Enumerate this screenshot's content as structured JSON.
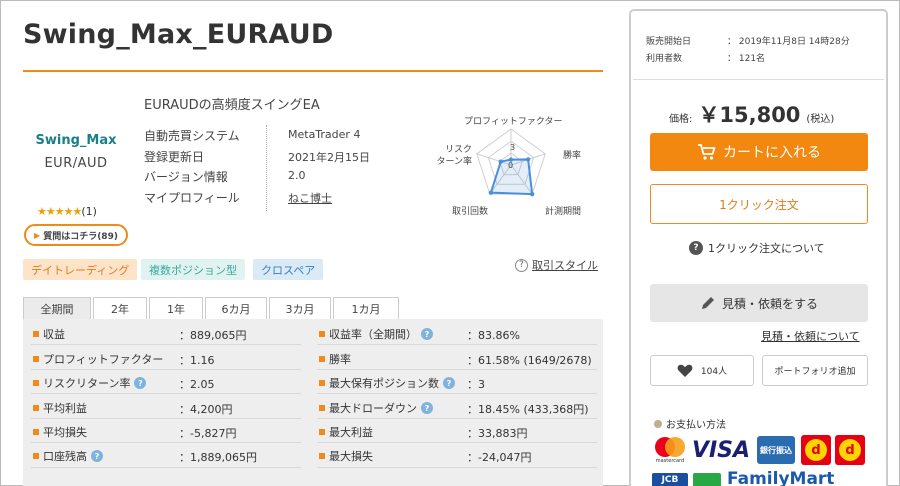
{
  "product": {
    "title": "Swing_Max_EURAUD",
    "subtitle": "EURAUDの高頻度スイングEA",
    "logo_top": "Swing_Max",
    "logo_bottom": "EUR/AUD",
    "stars": "★★★★★",
    "review_count": "(1)",
    "question_button": "質問はコチラ(89)",
    "info": [
      {
        "label": "自動売買システム",
        "value": "MetaTrader 4"
      },
      {
        "label": "登録更新日",
        "value": "2021年2月15日"
      },
      {
        "label": "バージョン情報",
        "value": "2.0"
      },
      {
        "label": "マイプロフィール",
        "value": "ねこ博士"
      }
    ]
  },
  "radar": {
    "labels": [
      "プロフィットファクター",
      "勝率",
      "計測期間",
      "取引回数",
      "リスク\nターン率"
    ],
    "scale_top": "3",
    "scale_center": "0",
    "values": [
      0.15,
      0.5,
      1.0,
      0.95,
      0.3
    ]
  },
  "tags": [
    "デイトレーディング",
    "複数ポジション型",
    "クロスペア"
  ],
  "trade_style_link": "取引スタイル",
  "periods": {
    "tabs": [
      "全期間",
      "2年",
      "1年",
      "6カ月",
      "3カ月",
      "1カ月"
    ],
    "active": 0
  },
  "stats": {
    "left": [
      {
        "label": "収益",
        "value": "：889,065円",
        "info": false
      },
      {
        "label": "プロフィットファクター",
        "value": "：1.16",
        "info": false
      },
      {
        "label": "リスクリターン率",
        "value": "：2.05",
        "info": true
      },
      {
        "label": "平均利益",
        "value": "：4,200円",
        "info": false
      },
      {
        "label": "平均損失",
        "value": "：-5,827円",
        "info": false
      },
      {
        "label": "口座残高",
        "value": "：1,889,065円",
        "info": true
      }
    ],
    "right": [
      {
        "label": "収益率（全期間）",
        "value": "：83.86%",
        "info": true
      },
      {
        "label": "勝率",
        "value": "：61.58% (1649/2678)",
        "info": false
      },
      {
        "label": "最大保有ポジション数",
        "value": "：3",
        "info": true
      },
      {
        "label": "最大ドローダウン",
        "value": "：18.45% (433,368円)",
        "info": true
      },
      {
        "label": "最大利益",
        "value": "：33,883円",
        "info": false
      },
      {
        "label": "最大損失",
        "value": "：-24,047円",
        "info": false
      }
    ]
  },
  "sidebar": {
    "sale_start_label": "販売開始日",
    "sale_start_value": "： 2019年11月8日 14時28分",
    "users_label": "利用者数",
    "users_value": "： 121名",
    "price_label": "価格:",
    "price": "￥15,800",
    "tax": "(税込)",
    "cart_button": "カートに入れる",
    "one_click_button": "1クリック注文",
    "about_one_click": "1クリック注文について",
    "quote_button": "見積・依頼をする",
    "about_quote": "見積・依頼について",
    "favorite_count": "104人",
    "portfolio_button": "ポートフォリオ追加",
    "payment_title": "お支払い方法",
    "payment_mastercard": "mastercard",
    "payment_visa": "VISA",
    "payment_bank": "銀行振込",
    "payment_jcb": "JCB",
    "payment_familymart": "FamilyMart"
  },
  "colors": {
    "accent": "#f08a1a",
    "cart": "#f2880f",
    "radar_line": "#4a90d9"
  }
}
